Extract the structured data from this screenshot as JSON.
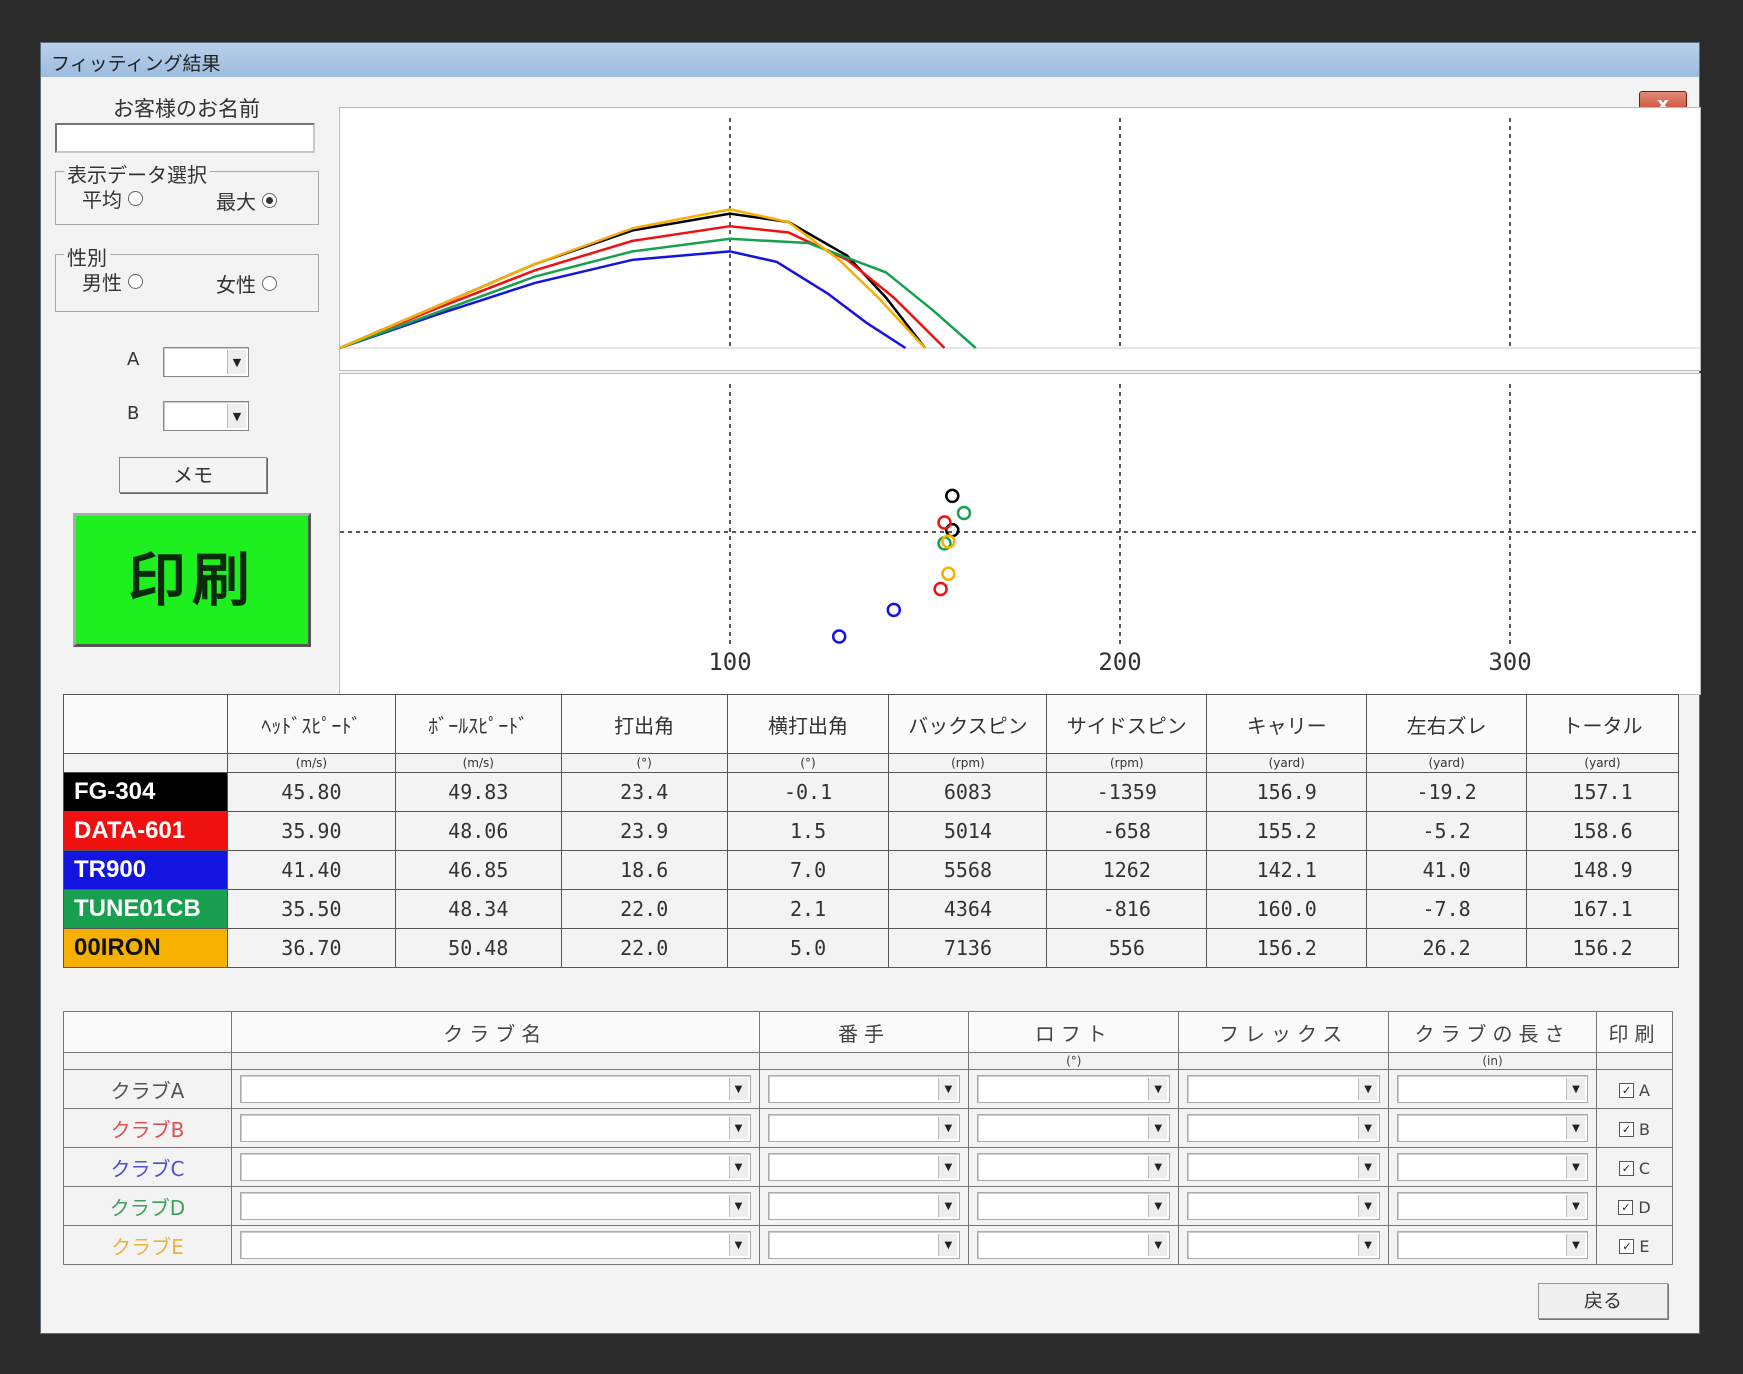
{
  "window": {
    "title": "フィッティング結果",
    "close_label": "x"
  },
  "sidebar": {
    "customer_label": "お客様のお名前",
    "customer_value": "",
    "display_group": {
      "title": "表示データ選択",
      "options": [
        "平均",
        "最大"
      ],
      "selected": "最大"
    },
    "gender_group": {
      "title": "性別",
      "options": [
        "男性",
        "女性"
      ],
      "selected": ""
    },
    "a_label": "A",
    "b_label": "B",
    "memo_label": "メモ",
    "print_label": "印刷"
  },
  "colors": {
    "FG-304": "#000000",
    "DATA-601": "#f01010",
    "TR900": "#1414e0",
    "TUNE01CB": "#18a050",
    "00IRON": "#f5b000"
  },
  "chart_data": [
    {
      "type": "line",
      "title": "",
      "xlim": [
        0,
        350
      ],
      "ylim": [
        0,
        40
      ],
      "xgrid": [
        100,
        200,
        300
      ],
      "series": [
        {
          "name": "FG-304",
          "color": "#000000",
          "x": [
            0,
            25,
            50,
            75,
            100,
            115,
            130,
            140,
            150
          ],
          "y": [
            0,
            10,
            20,
            28,
            32,
            30,
            22,
            12,
            0
          ]
        },
        {
          "name": "DATA-601",
          "color": "#f01010",
          "x": [
            0,
            25,
            50,
            75,
            100,
            115,
            130,
            142,
            155
          ],
          "y": [
            0,
            9.5,
            18.5,
            25.5,
            29,
            27.5,
            21,
            12,
            0
          ]
        },
        {
          "name": "TR900",
          "color": "#1414e0",
          "x": [
            0,
            25,
            50,
            75,
            100,
            112,
            125,
            135,
            145
          ],
          "y": [
            0,
            8,
            15.5,
            21,
            23,
            20.5,
            13,
            6,
            0
          ]
        },
        {
          "name": "TUNE01CB",
          "color": "#18a050",
          "x": [
            0,
            25,
            50,
            75,
            100,
            120,
            140,
            152,
            163
          ],
          "y": [
            0,
            8.5,
            17,
            23,
            26,
            25,
            18,
            9,
            0
          ]
        },
        {
          "name": "00IRON",
          "color": "#f5b000",
          "x": [
            0,
            25,
            50,
            75,
            100,
            115,
            128,
            138,
            150
          ],
          "y": [
            0,
            10,
            20,
            28.5,
            33,
            30,
            21,
            12,
            0
          ]
        }
      ]
    },
    {
      "type": "scatter",
      "title": "",
      "xlim": [
        0,
        350
      ],
      "xticks": [
        100,
        200,
        300
      ],
      "points": [
        {
          "series": "FG-304",
          "color": "#000000",
          "x": 157,
          "y": -19
        },
        {
          "series": "FG-304",
          "color": "#000000",
          "x": 157,
          "y": -1
        },
        {
          "series": "TUNE01CB",
          "color": "#18a050",
          "x": 160,
          "y": -10
        },
        {
          "series": "TUNE01CB",
          "color": "#18a050",
          "x": 155,
          "y": 6
        },
        {
          "series": "DATA-601",
          "color": "#f01010",
          "x": 155,
          "y": -5
        },
        {
          "series": "DATA-601",
          "color": "#f01010",
          "x": 154,
          "y": 30
        },
        {
          "series": "00IRON",
          "color": "#f5b000",
          "x": 156,
          "y": 5
        },
        {
          "series": "00IRON",
          "color": "#f5b000",
          "x": 156,
          "y": 22
        },
        {
          "series": "TR900",
          "color": "#1414e0",
          "x": 142,
          "y": 41
        },
        {
          "series": "TR900",
          "color": "#1414e0",
          "x": 128,
          "y": 55
        }
      ]
    }
  ],
  "stats": {
    "headers": [
      "ﾍｯﾄﾞｽﾋﾟｰﾄﾞ",
      "ﾎﾞｰﾙｽﾋﾟｰﾄﾞ",
      "打出角",
      "横打出角",
      "バックスピン",
      "サイドスピン",
      "キャリー",
      "左右ズレ",
      "トータル"
    ],
    "units": [
      "(m/s)",
      "(m/s)",
      "(°)",
      "(°)",
      "(rpm)",
      "(rpm)",
      "(yard)",
      "(yard)",
      "(yard)"
    ],
    "rows": [
      {
        "name": "FG-304",
        "bg": "#000000",
        "fg": "#ffffff",
        "values": [
          "45.80",
          "49.83",
          "23.4",
          "-0.1",
          "6083",
          "-1359",
          "156.9",
          "-19.2",
          "157.1"
        ]
      },
      {
        "name": "DATA-601",
        "bg": "#f01010",
        "fg": "#ffffff",
        "values": [
          "35.90",
          "48.06",
          "23.9",
          "1.5",
          "5014",
          "-658",
          "155.2",
          "-5.2",
          "158.6"
        ]
      },
      {
        "name": "TR900",
        "bg": "#1414e0",
        "fg": "#ffffff",
        "values": [
          "41.40",
          "46.85",
          "18.6",
          "7.0",
          "5568",
          "1262",
          "142.1",
          "41.0",
          "148.9"
        ]
      },
      {
        "name": "TUNE01CB",
        "bg": "#18a050",
        "fg": "#ffffff",
        "values": [
          "35.50",
          "48.34",
          "22.0",
          "2.1",
          "4364",
          "-816",
          "160.0",
          "-7.8",
          "167.1"
        ]
      },
      {
        "name": "00IRON",
        "bg": "#f5b000",
        "fg": "#111111",
        "values": [
          "36.70",
          "50.48",
          "22.0",
          "5.0",
          "7136",
          "556",
          "156.2",
          "26.2",
          "156.2"
        ]
      }
    ]
  },
  "clubs": {
    "headers": [
      "クラブ名",
      "番手",
      "ロフト",
      "フレックス",
      "クラブの長さ",
      "印刷"
    ],
    "units": [
      "",
      "",
      "(°)",
      "",
      "(in)",
      ""
    ],
    "rows": [
      {
        "label": "クラブA",
        "color": "#555555",
        "check": "A"
      },
      {
        "label": "クラブB",
        "color": "#e05050",
        "check": "B"
      },
      {
        "label": "クラブC",
        "color": "#5050d0",
        "check": "C"
      },
      {
        "label": "クラブD",
        "color": "#40a060",
        "check": "D"
      },
      {
        "label": "クラブE",
        "color": "#f0b040",
        "check": "E"
      }
    ]
  },
  "back_label": "戻る"
}
